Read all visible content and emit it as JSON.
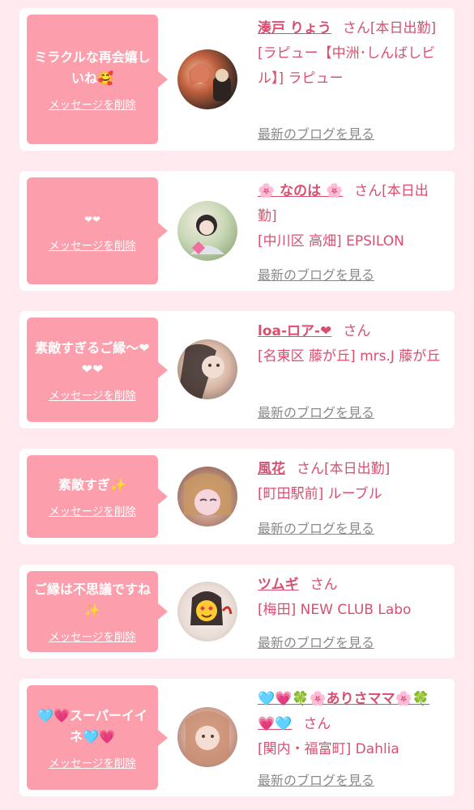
{
  "delete_label": "メッセージを削除",
  "blog_label": "最新のブログを見る",
  "honorific": "さん",
  "colors": {
    "background": "#fde9ee",
    "bubble": "#fc9eac",
    "accent": "#d94f70",
    "link_gray": "#8a8a8a"
  },
  "cards": [
    {
      "message": "ミラクルな再会嬉しいね🥰",
      "name": "湊戸 りょう",
      "detail": "[本日出勤]",
      "shop": "[ラピュー【中洲･しんばしビル】] ラピュー",
      "avatar": "avatar-photo-1"
    },
    {
      "message": "❤❤",
      "name": "🌸 なのは 🌸",
      "detail": "[本日出勤]",
      "shop": "[中川区 高畑] EPSILON",
      "avatar": "avatar-photo-2"
    },
    {
      "message": "素敵すぎるご縁〜❤❤❤",
      "name": "loa-ロア-❤",
      "detail": "",
      "shop": "[名東区 藤が丘] mrs.J 藤が丘",
      "avatar": "avatar-photo-3"
    },
    {
      "message": "素敵すぎ✨",
      "name": "風花",
      "detail": "[本日出勤]",
      "shop": "[町田駅前] ルーブル",
      "avatar": "avatar-photo-4"
    },
    {
      "message": "ご縁は不思議ですね✨",
      "name": "ツムギ",
      "detail": "",
      "shop": "[梅田] NEW CLUB Labo",
      "avatar": "avatar-photo-5"
    },
    {
      "message": "🩵💗スーパーイイネ🩵💗",
      "name": "🩵💗🍀🌸ありさママ🌸🍀💗🩵",
      "detail": "",
      "shop": "[関内・福富町] Dahlia",
      "avatar": "avatar-photo-6"
    }
  ]
}
